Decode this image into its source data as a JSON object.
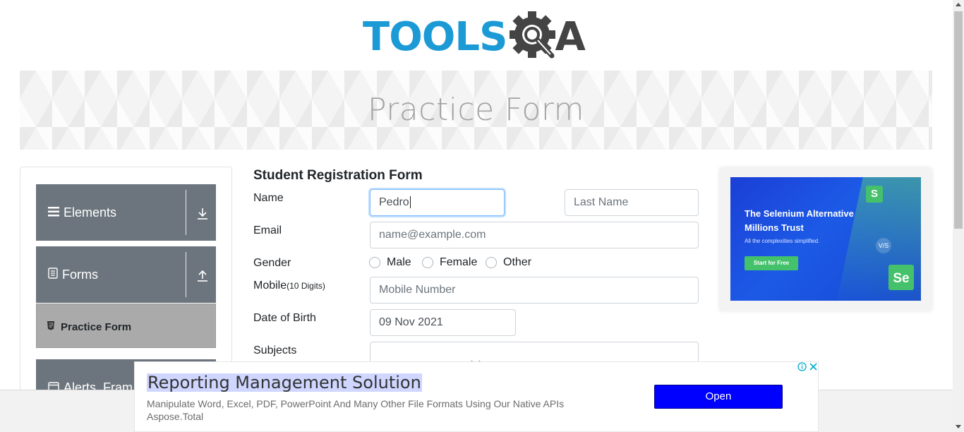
{
  "logo": {
    "text_main": "TOOLS",
    "text_end": "A",
    "icon": "gear-magnifier-icon",
    "main_color": "#1c9ad6",
    "dark_color": "#444444"
  },
  "banner": {
    "title": "Practice Form"
  },
  "sidebar": {
    "groups": [
      {
        "label": "Elements",
        "icon": "hamburger-icon",
        "toggle_icon": "download-arrow-icon"
      },
      {
        "label": "Forms",
        "icon": "document-icon",
        "toggle_icon": "upload-arrow-icon"
      },
      {
        "label": "Alerts, Fram",
        "icon": "window-icon"
      }
    ],
    "active_item": {
      "label": "Practice Form",
      "icon": "html5-icon"
    },
    "header_color": "#6c757d",
    "active_color": "#aaaaaa"
  },
  "form": {
    "title": "Student Registration Form",
    "name_label": "Name",
    "first_name_value": "Pedro",
    "last_name_placeholder": "Last Name",
    "email_label": "Email",
    "email_placeholder": "name@example.com",
    "gender_label": "Gender",
    "gender_options": [
      "Male",
      "Female",
      "Other"
    ],
    "mobile_label": "Mobile",
    "mobile_hint": "(10 Digits)",
    "mobile_placeholder": "Mobile Number",
    "dob_label": "Date of Birth",
    "dob_value": "09 Nov 2021",
    "subjects_label": "Subjects"
  },
  "side_ad": {
    "title": "The Selenium Alternative Millions Trust",
    "subtitle": "All the complexities simplified.",
    "button": "Start for Free",
    "logo_small": "S",
    "logo_large": "Se",
    "badge": "V/S"
  },
  "bottom_ad": {
    "title": "Reporting Management Solution",
    "description": "Manipulate Word, Excel, PDF, PowerPoint And Many Other File Formats Using Our Native APIs",
    "source": "Aspose.Total",
    "button": "Open",
    "info_icon": "info-icon",
    "close_icon": "close-icon"
  }
}
